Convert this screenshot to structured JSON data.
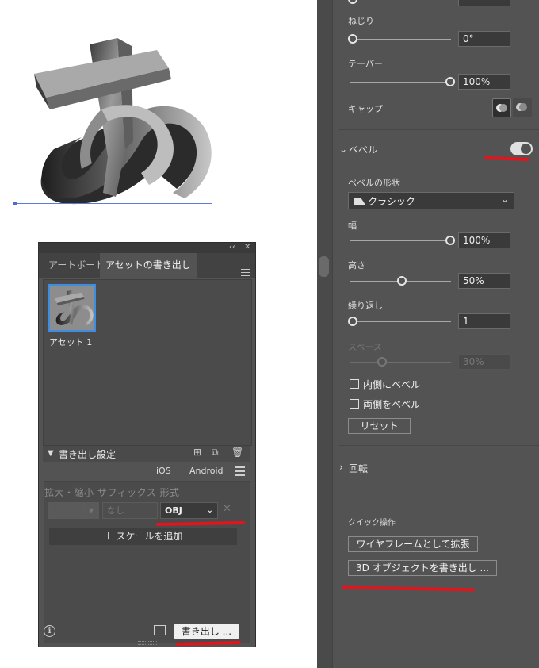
{
  "asset_panel": {
    "tabs": [
      "アートボード",
      "アセットの書き出し"
    ],
    "asset_label": "アセット 1",
    "section_title": "書き出し設定",
    "os_ios": "iOS",
    "os_android": "Android",
    "col_headers": "拡大・縮小  サフィックス  形式",
    "suffix_placeholder": "なし",
    "format_value": "OBJ",
    "add_scale_label": "スケールを追加",
    "export_button": "書き出し ..."
  },
  "right_panel": {
    "twist_label": "ねじり",
    "twist_value": "0°",
    "taper_label": "テーパー",
    "taper_value": "100%",
    "cap_label": "キャップ",
    "bevel_label": "ベベル",
    "bevel_enabled": true,
    "bevel_shape_label": "ベベルの形状",
    "bevel_shape_value": "クラシック",
    "width_label": "幅",
    "width_value": "100%",
    "height_label": "高さ",
    "height_value": "50%",
    "repeat_label": "繰り返し",
    "repeat_value": "1",
    "space_label": "スペース",
    "space_value": "30%",
    "inner_bevel_label": "内側にベベル",
    "both_bevel_label": "両側をベベル",
    "reset_button": "リセット",
    "rotation_label": "回転",
    "quick_actions_label": "クイック操作",
    "expand_wireframe_button": "ワイヤフレームとして拡張",
    "export_3d_button": "3D オブジェクトを書き出し ..."
  },
  "colors": {
    "panel_bg": "#535353",
    "annotation_red": "#e3141b",
    "selection_blue": "#3d8ee0"
  }
}
